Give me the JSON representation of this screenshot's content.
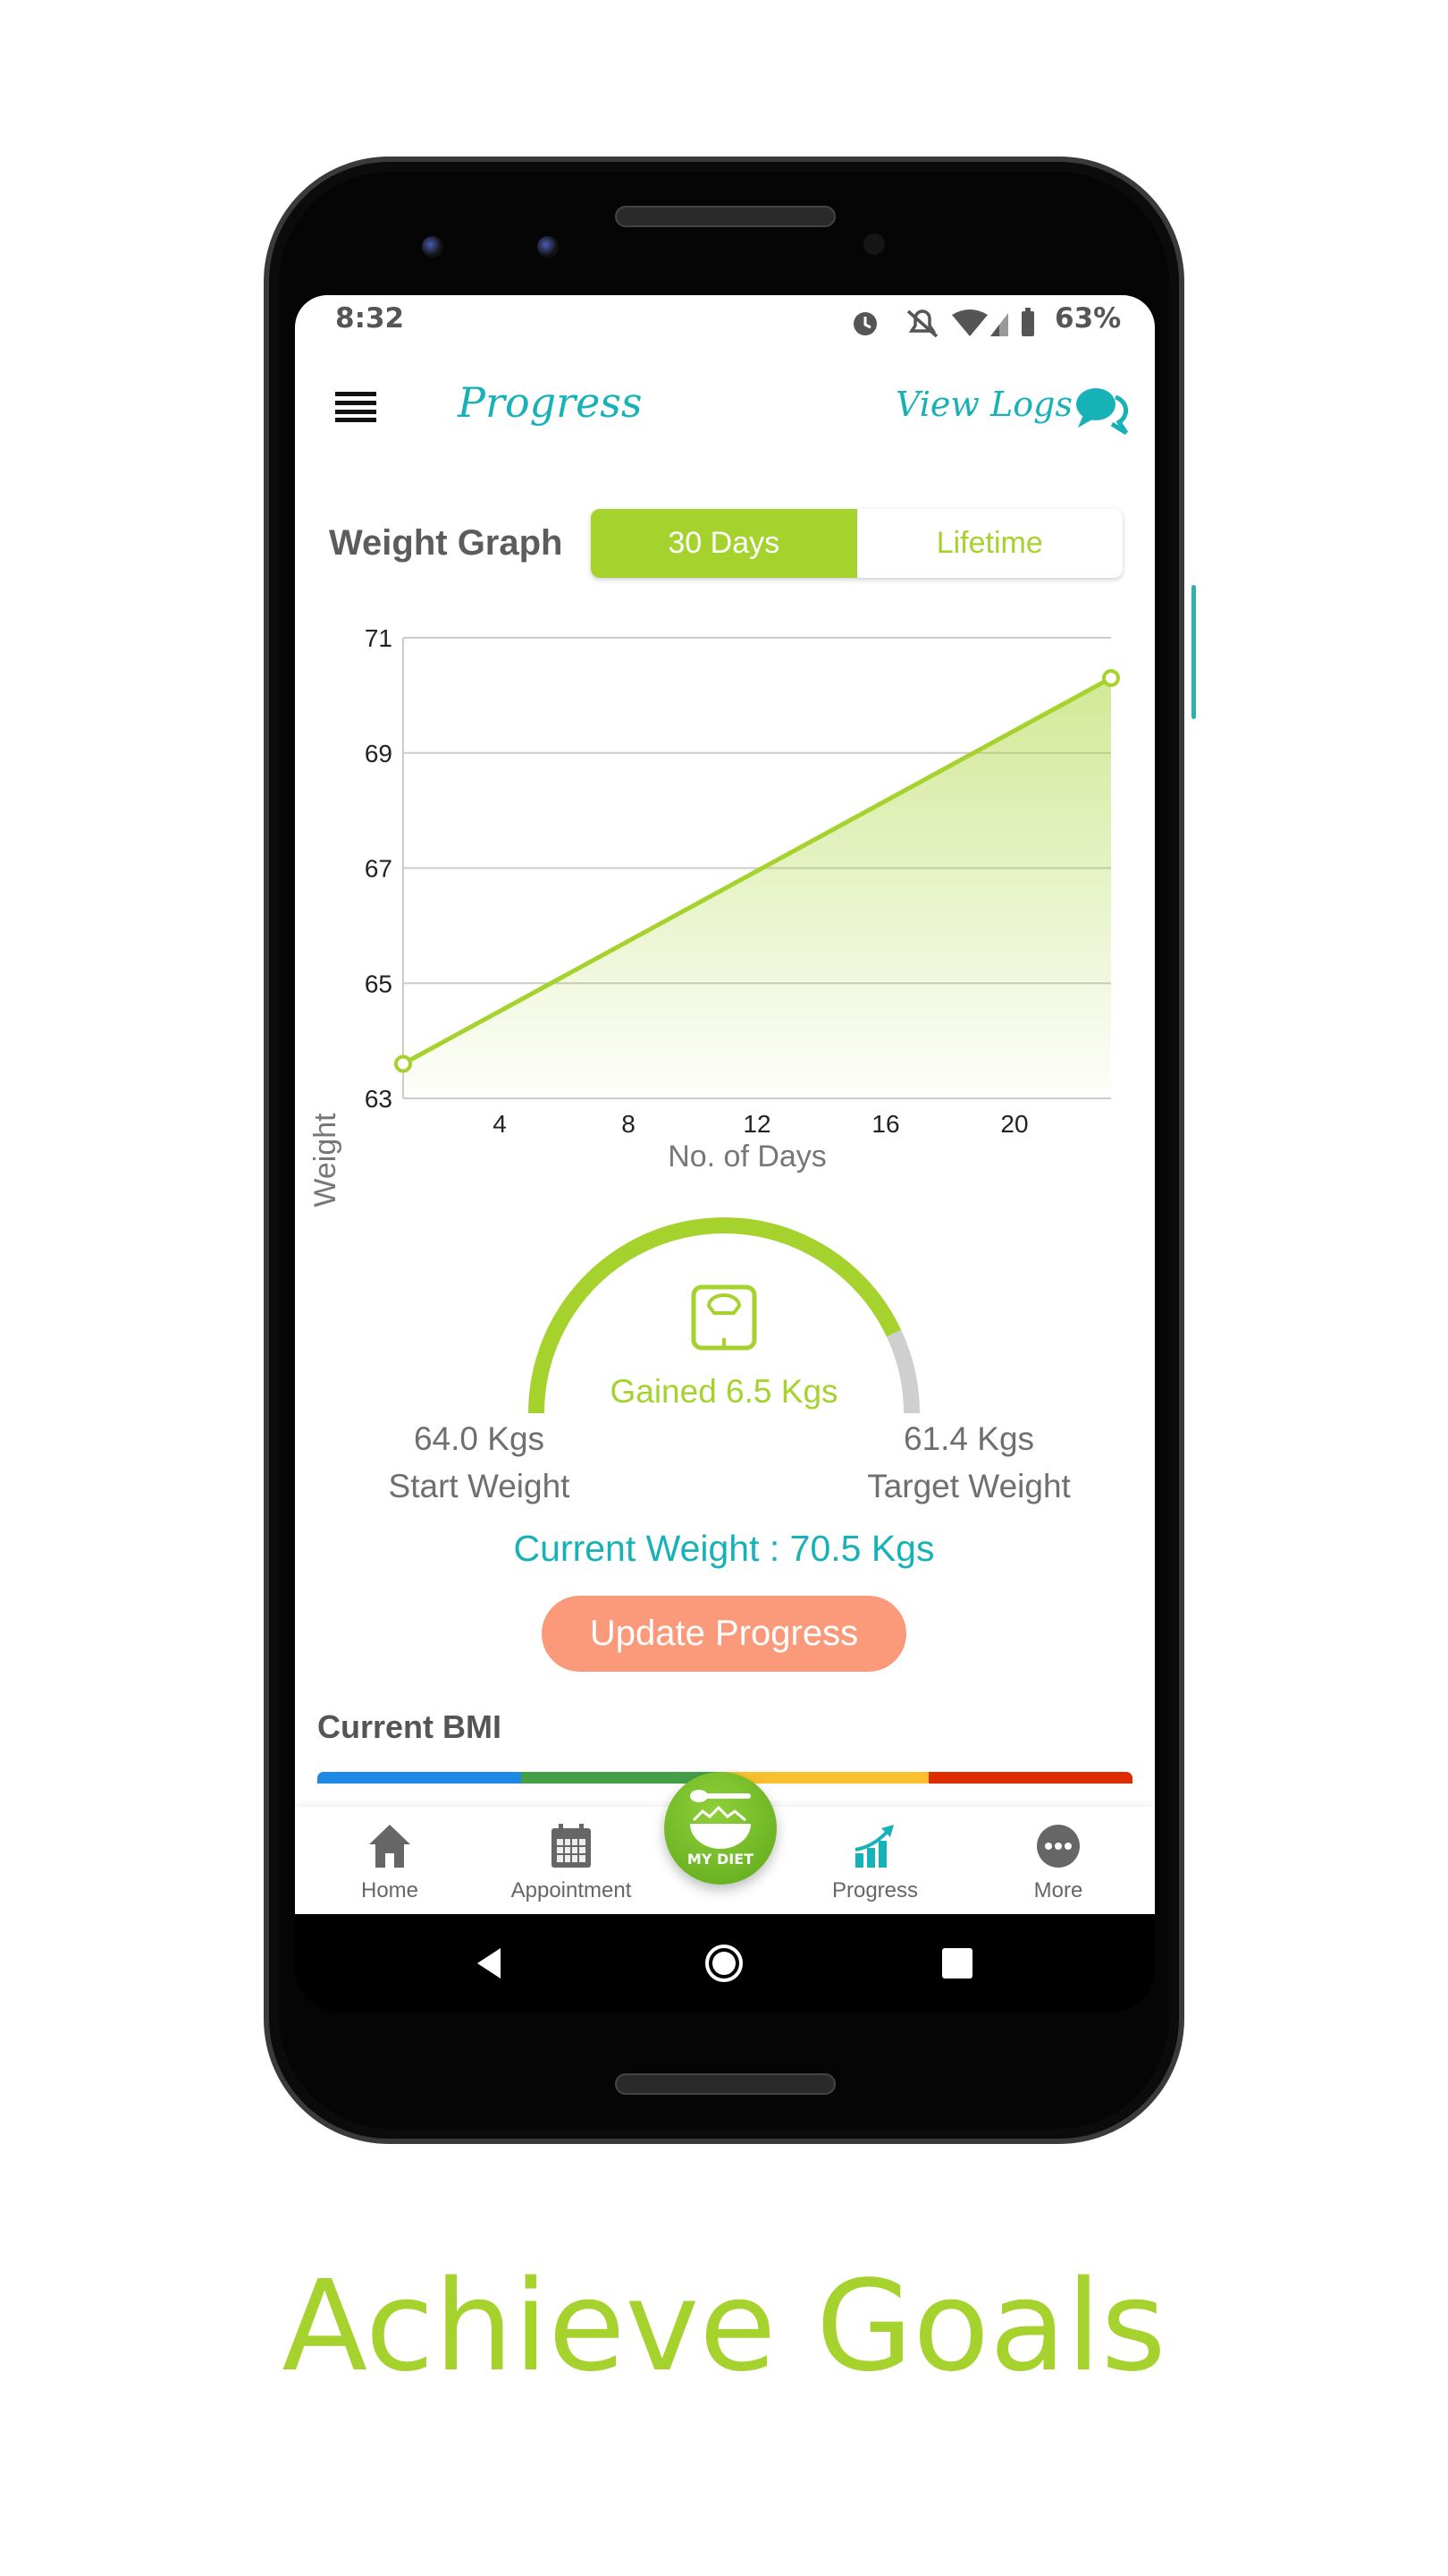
{
  "status_bar": {
    "time": "8:32",
    "battery": "63%",
    "icons": [
      "alarm-icon",
      "bell-off-icon",
      "wifi-icon",
      "signal-icon",
      "battery-icon"
    ]
  },
  "header": {
    "title": "Progress",
    "view_logs": "View Logs",
    "menu_icon": "hamburger-icon",
    "chat_icon": "chat-icon"
  },
  "weight_graph": {
    "label": "Weight Graph",
    "tabs": [
      {
        "label": "30 Days",
        "active": true
      },
      {
        "label": "Lifetime",
        "active": false
      }
    ]
  },
  "chart_data": {
    "type": "area",
    "xlabel": "No. of Days",
    "ylabel": "Weight",
    "xlim": [
      1,
      23
    ],
    "ylim": [
      63,
      71
    ],
    "x_ticks": [
      "4",
      "8",
      "12",
      "16",
      "20"
    ],
    "y_ticks": [
      "71",
      "69",
      "67",
      "65",
      "63"
    ],
    "grid": true,
    "points": [
      {
        "x": 1,
        "y": 63.6
      },
      {
        "x": 23,
        "y": 70.3
      }
    ],
    "color": "#a6d22e"
  },
  "gauge": {
    "gained": "Gained 6.5 Kgs",
    "progress_fraction": 0.86,
    "start_value": "64.0 Kgs",
    "start_label": "Start Weight",
    "target_value": "61.4 Kgs",
    "target_label": "Target Weight",
    "current": "Current Weight : 70.5 Kgs",
    "icon": "weighing-scale-icon"
  },
  "update_button": "Update Progress",
  "bmi": {
    "title": "Current BMI",
    "segment_colors": [
      "#1e88e5",
      "#43a047",
      "#fbc02d",
      "#dd2c00"
    ]
  },
  "bottom_nav": {
    "items": [
      {
        "label": "Home",
        "icon": "home-icon"
      },
      {
        "label": "Appointment",
        "icon": "calendar-icon"
      },
      {
        "label": "Progress",
        "icon": "chart-growth-icon"
      },
      {
        "label": "More",
        "icon": "more-icon"
      }
    ],
    "center": "MY DIET"
  },
  "tagline": "Achieve Goals",
  "colors": {
    "accent_green": "#a6d22e",
    "teal": "#17b1b8",
    "button": "#fb9a7b"
  }
}
